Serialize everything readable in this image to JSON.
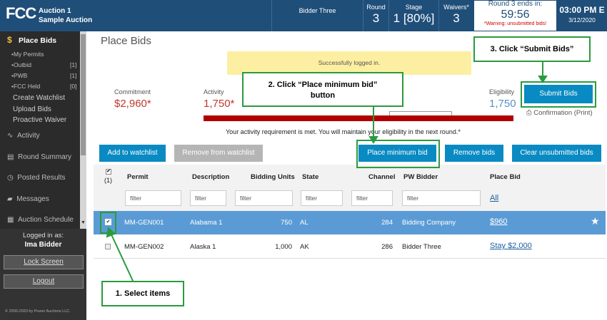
{
  "header": {
    "logo": "FCC",
    "auction_line1": "Auction 1",
    "auction_line2": "Sample Auction",
    "bidder": "Bidder Three",
    "round_label": "Round",
    "round_value": "3",
    "stage_label": "Stage",
    "stage_value": "1 [80%]",
    "waivers_label": "Waivers*",
    "waivers_value": "3",
    "round_ends_label": "Round 3 ends in:",
    "countdown": "59:56",
    "warning": "*Warning: unsubmitted bids!",
    "clock_time": "03:00 PM E",
    "clock_date": "3/12/2020"
  },
  "sidebar": {
    "active": "Place Bids",
    "sub_items": [
      {
        "label": "•My Permits",
        "count": ""
      },
      {
        "label": "•Outbid",
        "count": "[1]"
      },
      {
        "label": "•PWB",
        "count": "[1]"
      },
      {
        "label": "•FCC Held",
        "count": "[0]"
      }
    ],
    "links": [
      "Create Watchlist",
      "Upload Bids",
      "Proactive Waiver"
    ],
    "nav": [
      "Activity",
      "Round Summary",
      "Posted Results",
      "Messages",
      "Auction Schedule"
    ],
    "logged_in_label": "Logged in as:",
    "user": "Ima Bidder",
    "lock_screen": "Lock Screen",
    "logout": "Logout",
    "copyright": "© 2000-2020 by Power Auctions LLC."
  },
  "main": {
    "title": "Place Bids",
    "alert": "Successfully logged in.",
    "commitment_label": "Commitment",
    "commitment_value": "$2,960*",
    "activity_label": "Activity",
    "activity_value": "1,750*",
    "eligibility_label": "Eligibility",
    "eligibility_value": "1,750",
    "submit_bids": "Submit Bids",
    "confirmation": "Confirmation (Print)",
    "activity_note": "Your activity requirement is met. You will maintain your eligibility in the next round.*",
    "buttons": {
      "add_watchlist": "Add to watchlist",
      "remove_watchlist": "Remove from watchlist",
      "place_min": "Place minimum bid",
      "remove_bids": "Remove bids",
      "clear_unsubmitted": "Clear unsubmitted bids"
    }
  },
  "table": {
    "select_count": "(1)",
    "headers": [
      "Permit",
      "Description",
      "Bidding Units",
      "State",
      "Channel",
      "PW Bidder",
      "Place Bid"
    ],
    "filter_placeholder": "filter",
    "all_link": "All",
    "rows": [
      {
        "permit": "MM-GEN001",
        "description": "Alabama 1",
        "units": "750",
        "state": "AL",
        "channel": "284",
        "pw_bidder": "Bidding Company",
        "place_bid": "$960",
        "selected": true
      },
      {
        "permit": "MM-GEN002",
        "description": "Alaska 1",
        "units": "1,000",
        "state": "AK",
        "channel": "286",
        "pw_bidder": "Bidder Three",
        "place_bid": "Stay $2,000",
        "selected": false
      }
    ]
  },
  "callouts": {
    "step1": "1.  Select items",
    "step2_line1": "2.  Click “Place minimum bid”",
    "step2_line2": "button",
    "step3": "3.  Click “Submit Bids”"
  },
  "colors": {
    "header": "#1f4e79",
    "accent": "#0a8ac2",
    "selected_row": "#5b9bd5",
    "callout": "#2a9b3e",
    "commitment": "#c0392b"
  }
}
